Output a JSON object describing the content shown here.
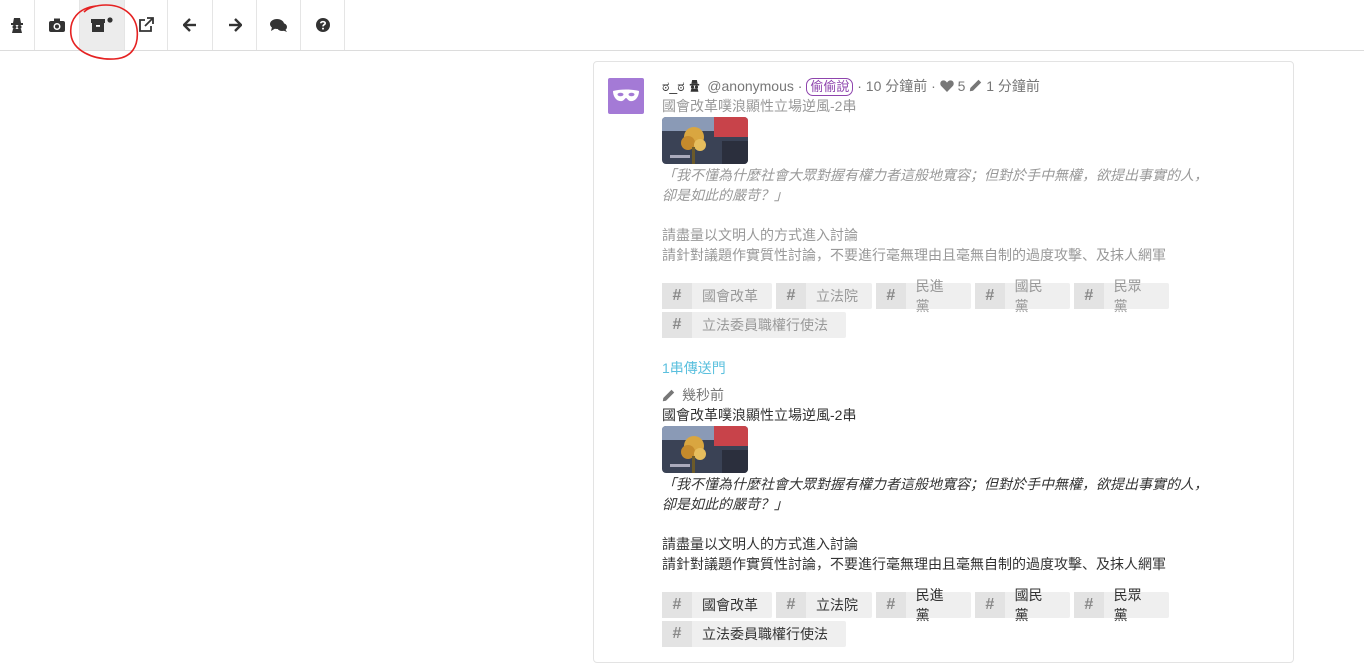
{
  "toolbar": {
    "buttons": [
      {
        "name": "spy-icon-button",
        "icon": "spy-icon"
      },
      {
        "name": "camera-button",
        "icon": "camera-icon"
      },
      {
        "name": "archive-button",
        "icon": "archive-icon",
        "active": true
      },
      {
        "name": "external-link-button",
        "icon": "external-link-icon"
      },
      {
        "name": "back-button",
        "icon": "arrow-left-icon"
      },
      {
        "name": "forward-button",
        "icon": "arrow-right-icon"
      },
      {
        "name": "comments-button",
        "icon": "comments-icon"
      },
      {
        "name": "help-button",
        "icon": "question-circle-icon"
      }
    ]
  },
  "post": {
    "avatar_icon": "mask-icon",
    "avatar_color": "#a47ad6",
    "nickname": "ಠ_ಠ",
    "handle": "@anonymous",
    "badge": "偷偷說",
    "time": "10 分鐘前",
    "likes": "5",
    "edit_time": "1 分鐘前",
    "old_version": {
      "title": "國會改革噗浪顯性立場逆風-2串",
      "quote_line1": "「我不懂為什麼社會大眾對握有權力者這般地寬容；但對於手中無權，欲提出事實的人，",
      "quote_line2": "卻是如此的嚴苛？」",
      "line1": "請盡量以文明人的方式進入討論",
      "line2": "請針對議題作實質性討論，不要進行毫無理由且毫無自制的過度攻擊、及抹人網軍",
      "tags": [
        "國會改革",
        "立法院",
        "民進黨",
        "國民黨",
        "民眾黨",
        "立法委員職權行使法"
      ]
    },
    "portal": "1串傳送門",
    "edited_label": "幾秒前",
    "new_version": {
      "title": "國會改革噗浪顯性立場逆風-2串",
      "quote_line1": "「我不懂為什麼社會大眾對握有權力者這般地寬容；但對於手中無權，欲提出事實的人，",
      "quote_line2": "卻是如此的嚴苛？」",
      "line1": "請盡量以文明人的方式進入討論",
      "line2": "請針對議題作實質性討論，不要進行毫無理由且毫無自制的過度攻擊、及抹人網軍",
      "tags": [
        "國會改革",
        "立法院",
        "民進黨",
        "國民黨",
        "民眾黨",
        "立法委員職權行使法"
      ]
    }
  }
}
